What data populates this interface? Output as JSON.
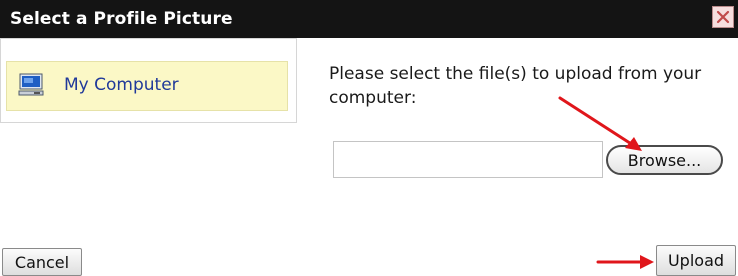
{
  "dialog": {
    "title": "Select a Profile Picture",
    "close_icon": "close-icon"
  },
  "sidebar": {
    "items": [
      {
        "label": "My Computer",
        "icon": "computer-icon",
        "selected": true
      }
    ]
  },
  "main": {
    "instructions": "Please select the file(s) to upload from your computer:",
    "file_input_value": "",
    "browse_label": "Browse..."
  },
  "footer": {
    "cancel_label": "Cancel",
    "upload_label": "Upload"
  },
  "annotations": {
    "arrow_color": "#e0161b"
  },
  "colors": {
    "titlebar_bg": "#141414",
    "selected_item_bg": "#fbf8c6",
    "link_text": "#20399a"
  }
}
